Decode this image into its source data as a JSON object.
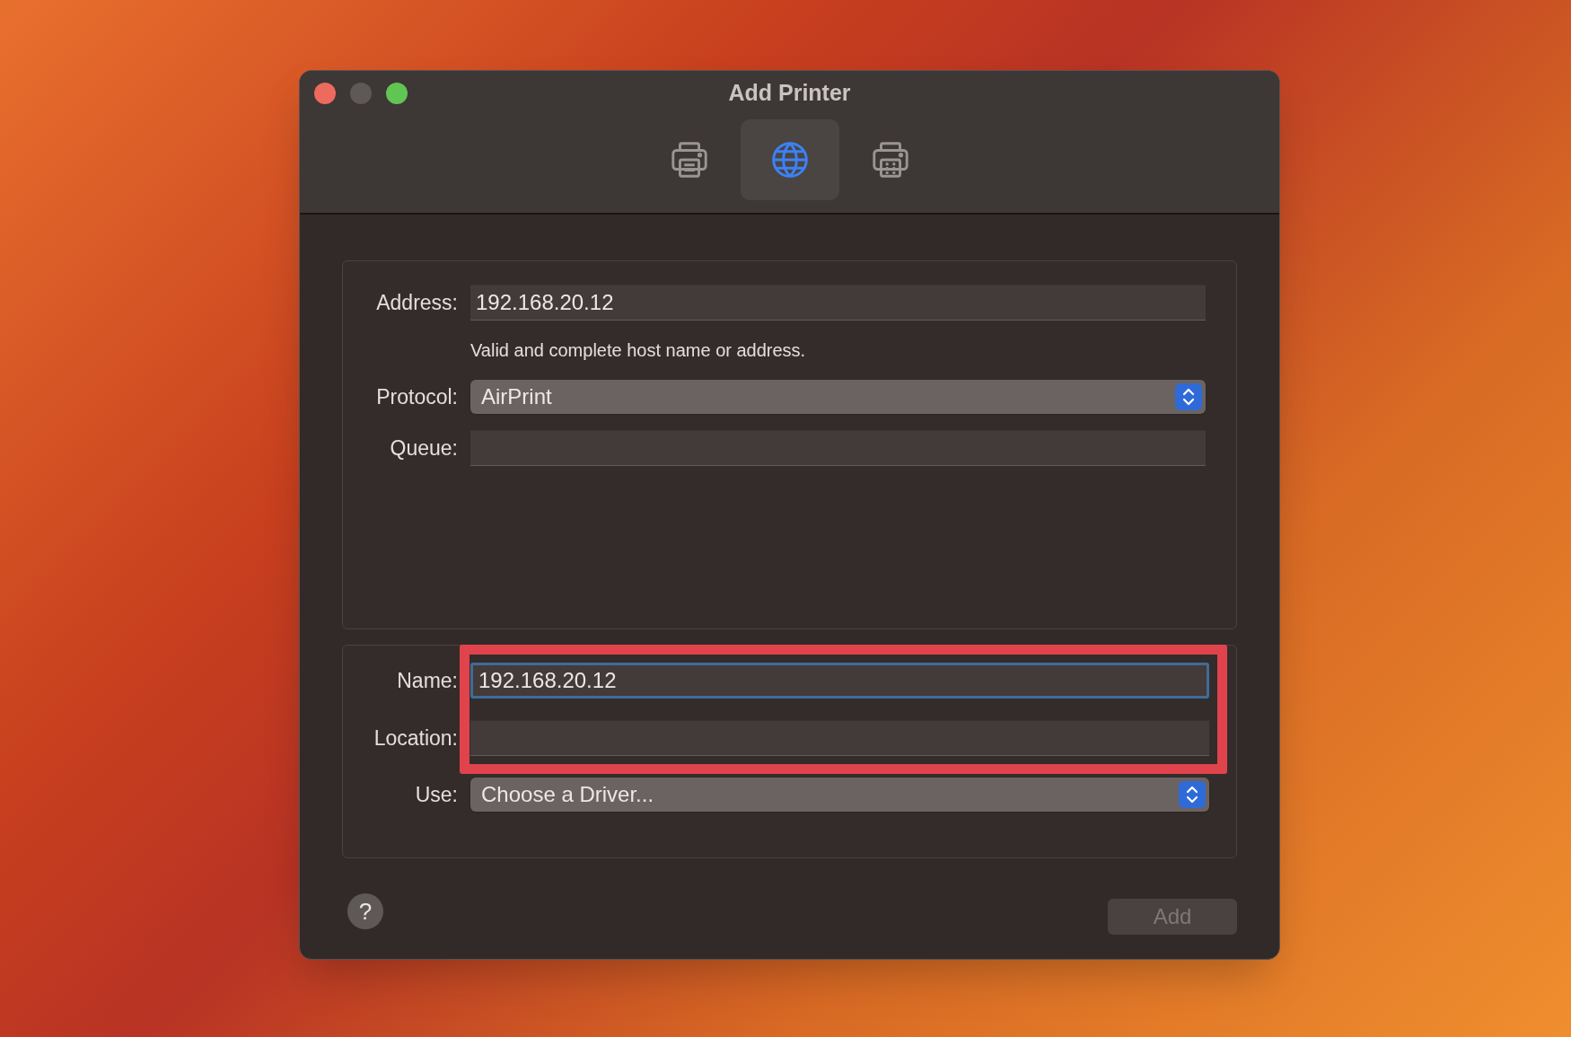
{
  "window": {
    "title": "Add Printer"
  },
  "toolbar": [
    {
      "kind": "printer",
      "selected": false
    },
    {
      "kind": "globe",
      "selected": true
    },
    {
      "kind": "printer-grid",
      "selected": false
    }
  ],
  "connection": [
    {
      "kind": "text",
      "label": "Address:",
      "value": "192.168.20.12",
      "hint": "Valid and complete host name or address."
    },
    {
      "kind": "popup",
      "label": "Protocol:",
      "value": "AirPrint"
    },
    {
      "kind": "text",
      "label": "Queue:"
    }
  ],
  "printer_info": [
    {
      "kind": "text",
      "label": "Name:",
      "value": "192.168.20.12",
      "focused": true,
      "highlighted": true
    },
    {
      "kind": "text",
      "label": "Location:",
      "focused": false,
      "highlighted": true
    },
    {
      "kind": "popup",
      "label": "Use:",
      "value": "Choose a Driver...",
      "highlighted": false
    }
  ],
  "help_button": "?",
  "add_button": {
    "label": "Add",
    "disabled": true
  }
}
